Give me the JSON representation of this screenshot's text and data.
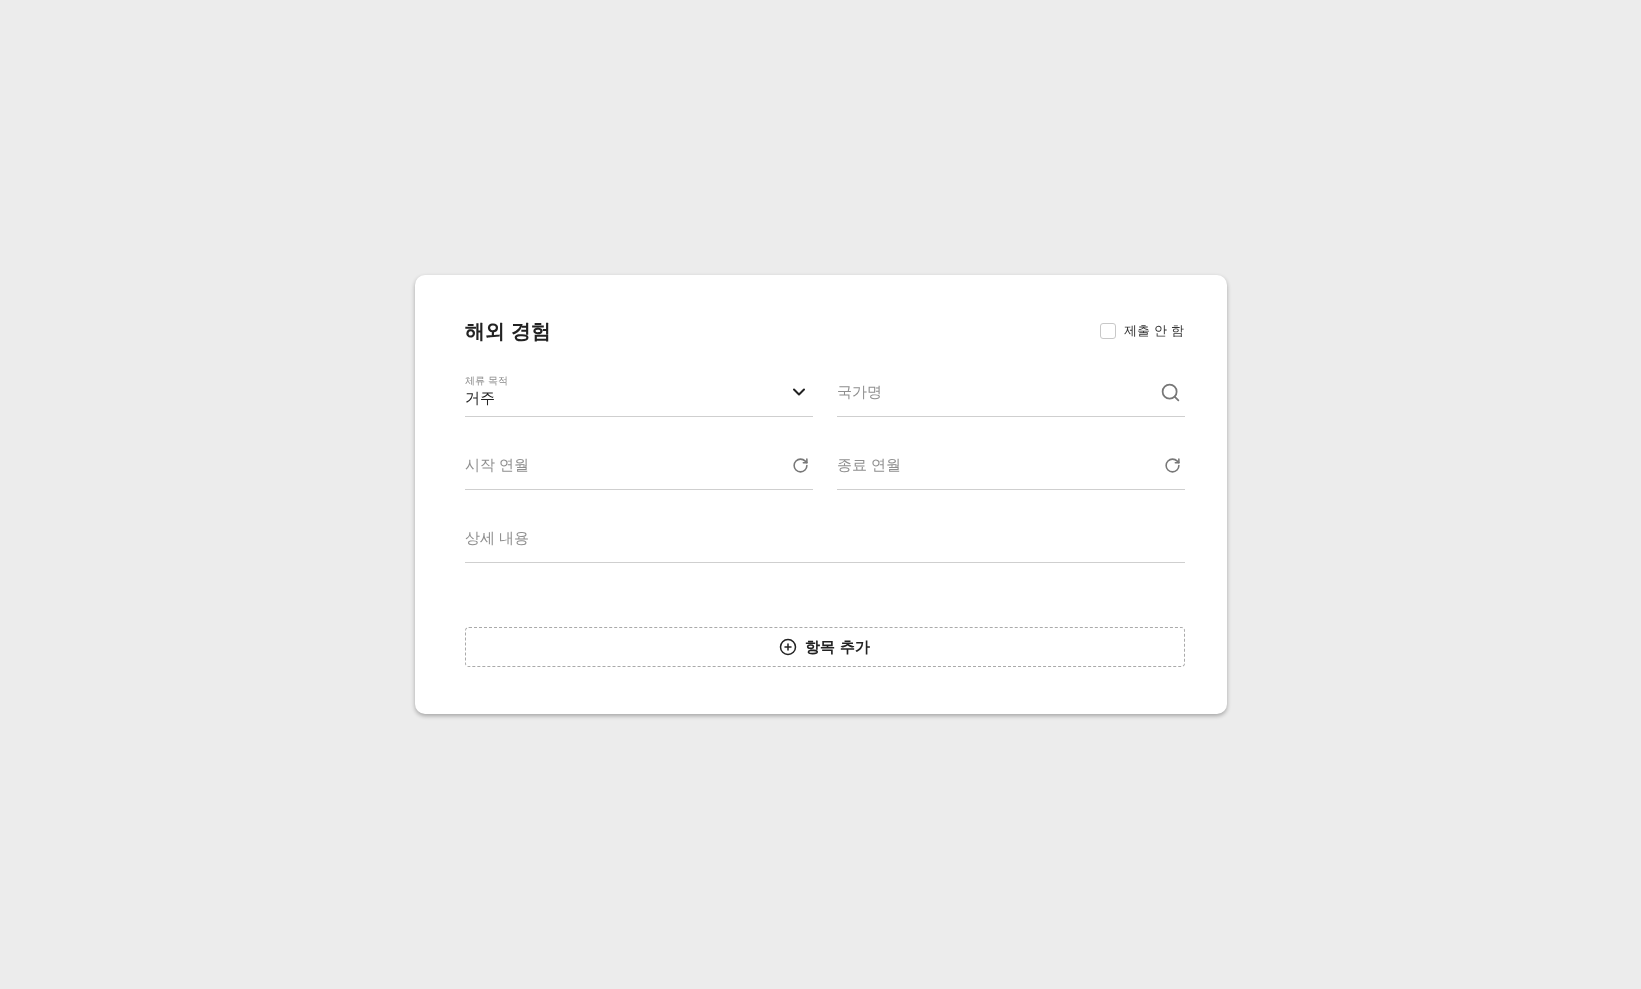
{
  "card": {
    "title": "해외 경험",
    "not_submitted": {
      "label": "제출 안 함",
      "checked": false
    },
    "fields": [
      {
        "kind": "select",
        "label": "체류 목적",
        "value": "거주"
      },
      {
        "kind": "search",
        "placeholder": "국가명"
      },
      {
        "kind": "date",
        "placeholder": "시작 연월"
      },
      {
        "kind": "date",
        "placeholder": "종료 연월"
      },
      {
        "kind": "text",
        "placeholder": "상세 내용"
      }
    ],
    "add_button": {
      "label": "항목 추가"
    }
  }
}
